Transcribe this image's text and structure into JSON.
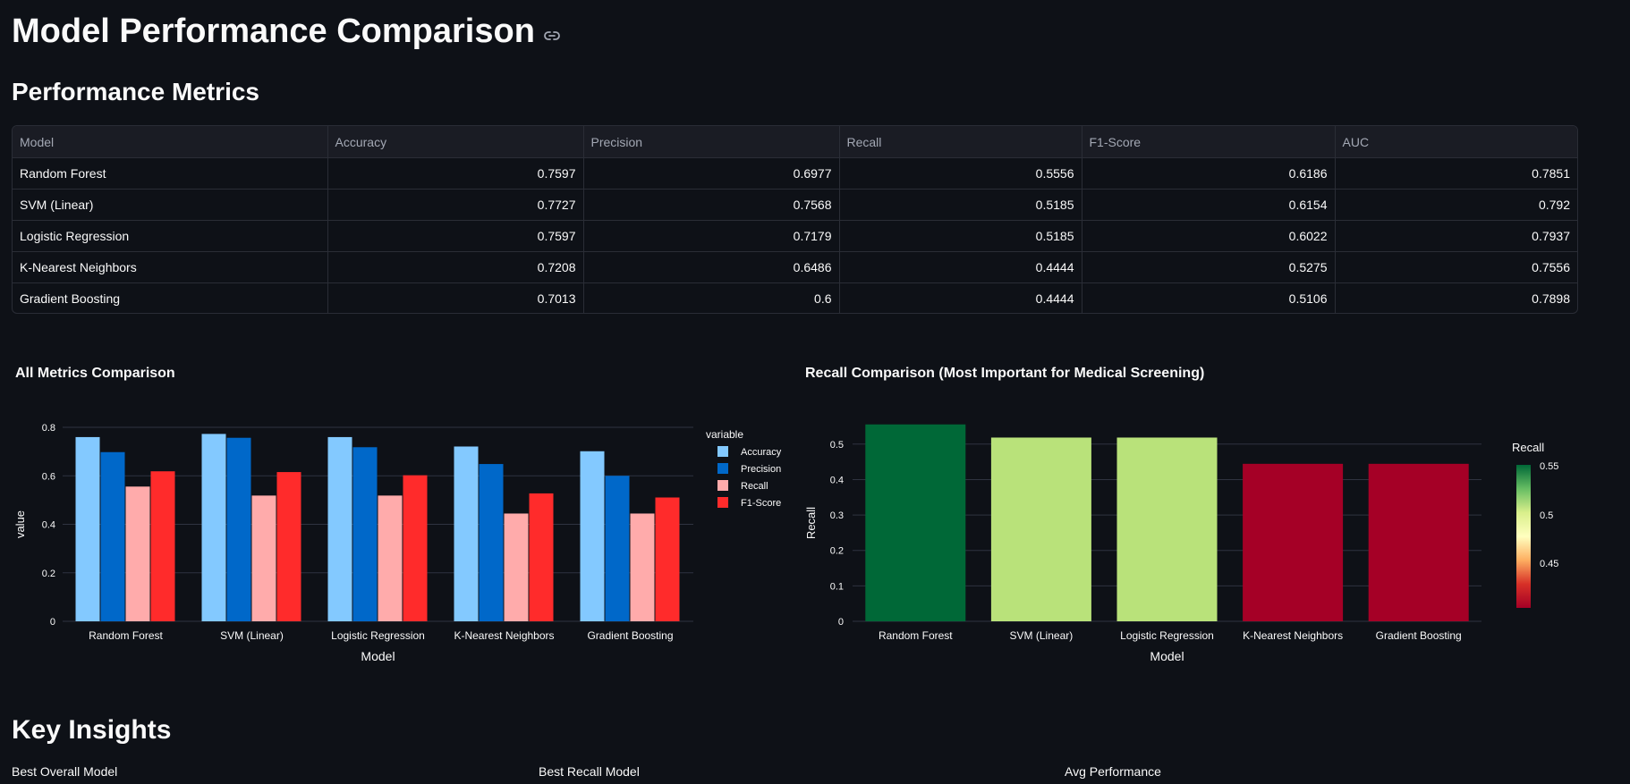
{
  "page": {
    "title": "Model Performance Comparison",
    "section_metrics": "Performance Metrics",
    "section_insights": "Key Insights"
  },
  "table": {
    "columns": [
      "Model",
      "Accuracy",
      "Precision",
      "Recall",
      "F1-Score",
      "AUC"
    ],
    "rows": [
      [
        "Random Forest",
        "0.7597",
        "0.6977",
        "0.5556",
        "0.6186",
        "0.7851"
      ],
      [
        "SVM (Linear)",
        "0.7727",
        "0.7568",
        "0.5185",
        "0.6154",
        "0.792"
      ],
      [
        "Logistic Regression",
        "0.7597",
        "0.7179",
        "0.5185",
        "0.6022",
        "0.7937"
      ],
      [
        "K-Nearest Neighbors",
        "0.7208",
        "0.6486",
        "0.4444",
        "0.5275",
        "0.7556"
      ],
      [
        "Gradient Boosting",
        "0.7013",
        "0.6",
        "0.4444",
        "0.5106",
        "0.7898"
      ]
    ]
  },
  "chart_data": [
    {
      "type": "bar",
      "title": "All Metrics Comparison",
      "xlabel": "Model",
      "ylabel": "value",
      "ylim": [
        0,
        0.8
      ],
      "yticks": [
        "0",
        "0.2",
        "0.4",
        "0.6",
        "0.8"
      ],
      "legend_title": "variable",
      "legend_position": "right",
      "categories": [
        "Random Forest",
        "SVM (Linear)",
        "Logistic Regression",
        "K-Nearest Neighbors",
        "Gradient Boosting"
      ],
      "series": [
        {
          "name": "Accuracy",
          "color": "#83c9ff",
          "values": [
            0.7597,
            0.7727,
            0.7597,
            0.7208,
            0.7013
          ]
        },
        {
          "name": "Precision",
          "color": "#0068c9",
          "values": [
            0.6977,
            0.7568,
            0.7179,
            0.6486,
            0.6
          ]
        },
        {
          "name": "Recall",
          "color": "#ffabab",
          "values": [
            0.5556,
            0.5185,
            0.5185,
            0.4444,
            0.4444
          ]
        },
        {
          "name": "F1-Score",
          "color": "#ff2b2b",
          "values": [
            0.6186,
            0.6154,
            0.6022,
            0.5275,
            0.5106
          ]
        }
      ]
    },
    {
      "type": "bar",
      "title": "Recall Comparison (Most Important for Medical Screening)",
      "xlabel": "Model",
      "ylabel": "Recall",
      "ylim": [
        0,
        0.5556
      ],
      "yticks": [
        "0",
        "0.1",
        "0.2",
        "0.3",
        "0.4",
        "0.5"
      ],
      "categories": [
        "Random Forest",
        "SVM (Linear)",
        "Logistic Regression",
        "K-Nearest Neighbors",
        "Gradient Boosting"
      ],
      "values": [
        0.5556,
        0.5185,
        0.5185,
        0.4444,
        0.4444
      ],
      "colors": [
        "#006837",
        "#b9e27a",
        "#b9e27a",
        "#a50026",
        "#a50026"
      ],
      "colorbar": {
        "title": "Recall",
        "ticks": [
          "0.55",
          "0.5",
          "0.45"
        ],
        "gradient": [
          "#006837",
          "#66bd63",
          "#d9ef8b",
          "#ffffbf",
          "#fdae61",
          "#d73027",
          "#a50026"
        ]
      }
    }
  ],
  "insights": {
    "labels": [
      "Best Overall Model",
      "Best Recall Model",
      "Avg Performance"
    ]
  },
  "colors": {
    "background": "#0e1117",
    "table_header": "#1a1c24",
    "border": "#2a2d36",
    "grid": "#2f3340"
  }
}
